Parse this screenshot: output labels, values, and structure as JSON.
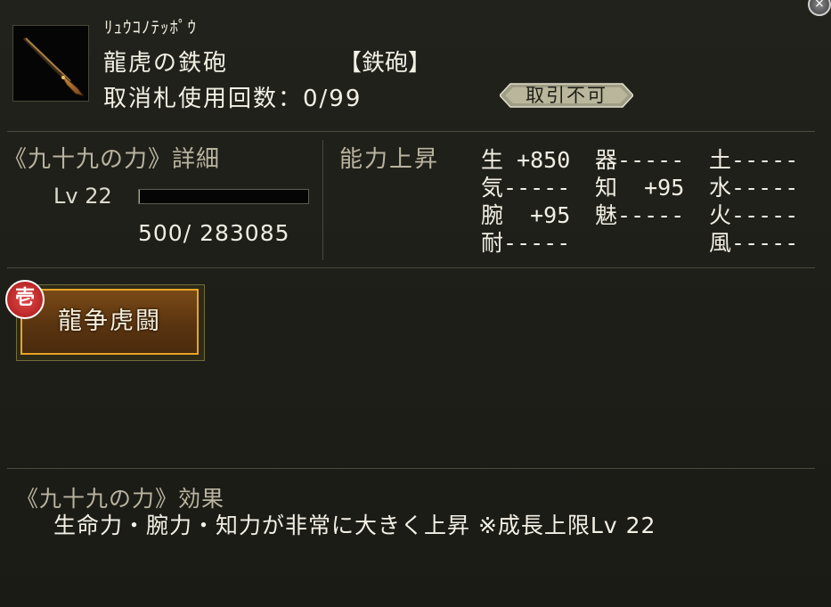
{
  "item": {
    "kana": "ﾘｭｳｺﾉﾃｯﾎﾟｳ",
    "name": "龍虎の鉄砲",
    "type": "【鉄砲】",
    "use_count": "取消札使用回数：0/99",
    "trade_status": "取引不可",
    "icon": "matchlock-rifle-icon"
  },
  "detail": {
    "title": "《九十九の力》詳細",
    "level": "Lv 22",
    "exp": "500/  283085",
    "exp_progress": 0.0018
  },
  "ability": {
    "title": "能力上昇",
    "stats": [
      {
        "k": "生",
        "v": " +850"
      },
      {
        "k": "器",
        "v": "-----"
      },
      {
        "k": "土",
        "v": "-----"
      },
      {
        "k": "気",
        "v": "-----"
      },
      {
        "k": "知",
        "v": "  +95"
      },
      {
        "k": "水",
        "v": "-----"
      },
      {
        "k": "腕",
        "v": "  +95"
      },
      {
        "k": "魅",
        "v": "-----"
      },
      {
        "k": "火",
        "v": "-----"
      },
      {
        "k": "耐",
        "v": "-----"
      },
      {
        "k": "風",
        "v": "-----"
      }
    ]
  },
  "skill": {
    "label": "龍争虎闘",
    "seal": "壱"
  },
  "effect": {
    "title": "《九十九の力》効果",
    "text": "生命力・腕力・知力が非常に大きく上昇 ※成長上限Lv 22"
  },
  "colors": {
    "background": "#1e1e19",
    "section_title": "#b9b4a0",
    "skill_border": "#e8a526",
    "seal_red": "#c02828"
  }
}
